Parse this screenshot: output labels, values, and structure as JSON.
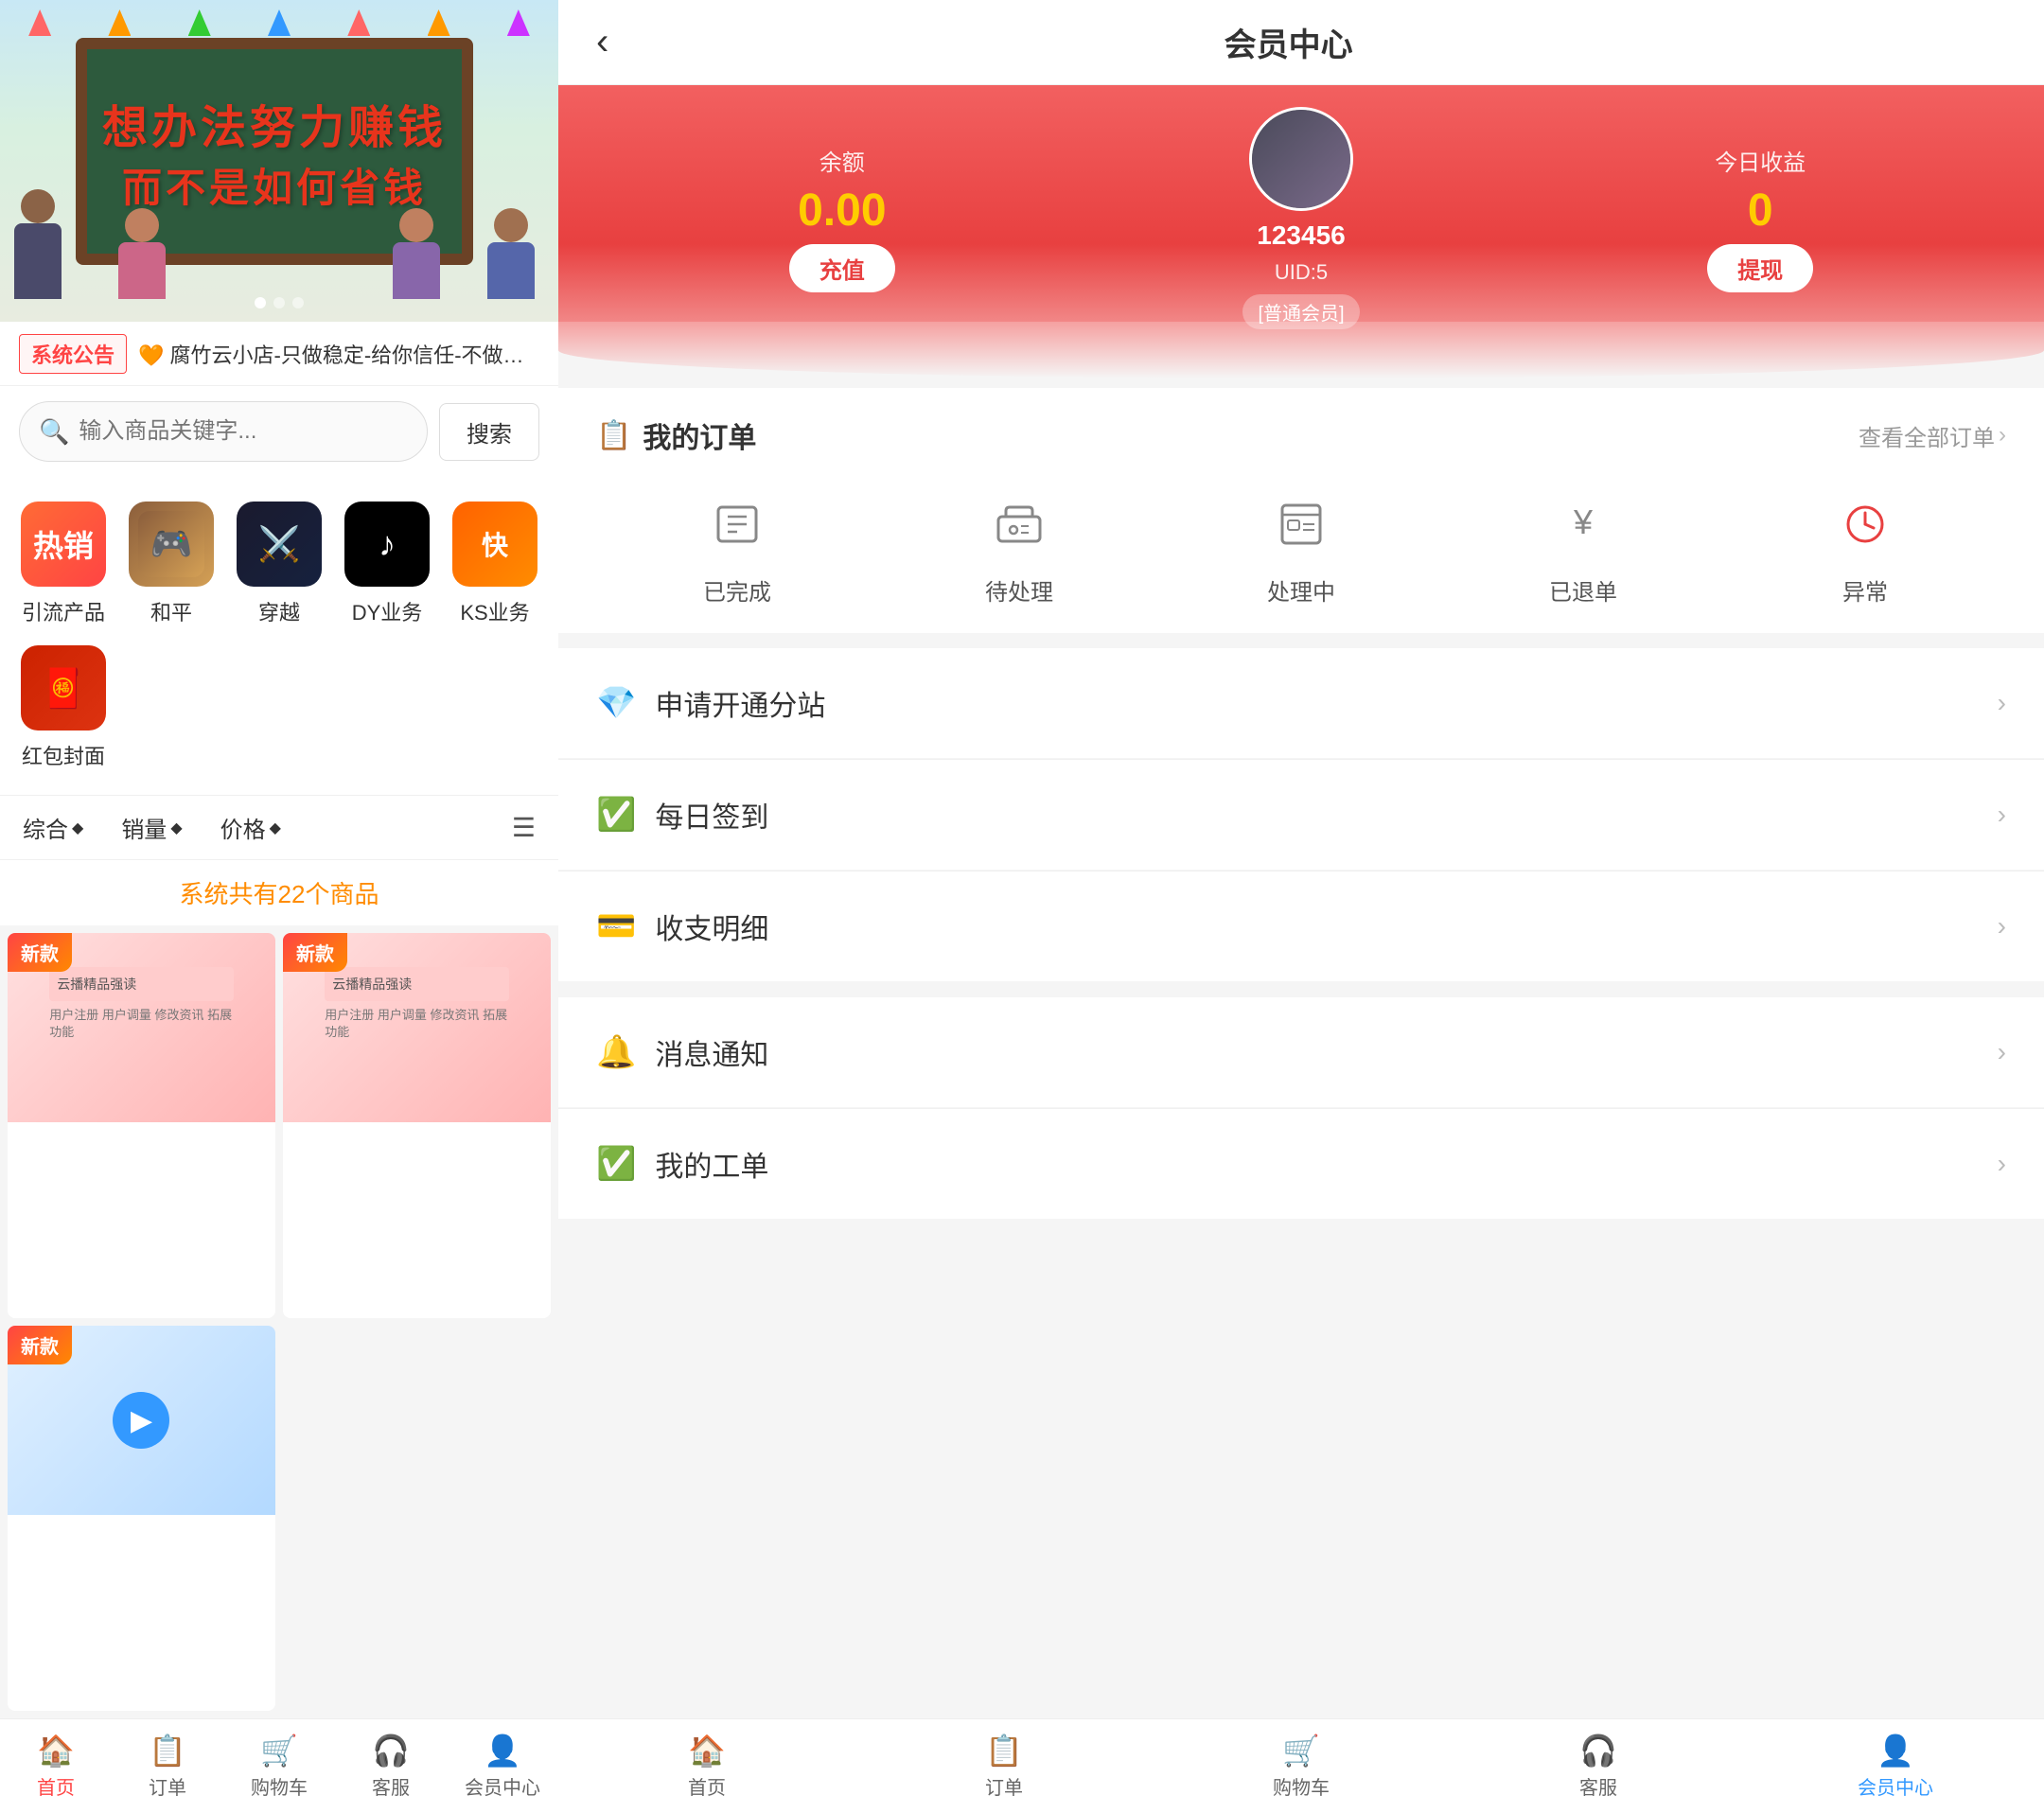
{
  "left": {
    "banner": {
      "text1": "想办法努力赚钱",
      "text2": "而不是如何省钱"
    },
    "notice": {
      "tag": "系统公告",
      "text": "🧡腐竹云小店-只做稳定-给你信任-不做跑路狗-售后稳定"
    },
    "search": {
      "placeholder": "输入商品关键字...",
      "button": "搜索"
    },
    "categories": [
      {
        "id": "hot",
        "label": "引流产品",
        "icon": "热销",
        "type": "hot"
      },
      {
        "id": "peace",
        "label": "和平",
        "icon": "",
        "type": "peace"
      },
      {
        "id": "cross",
        "label": "穿越",
        "icon": "",
        "type": "cross"
      },
      {
        "id": "dy",
        "label": "DY业务",
        "icon": "",
        "type": "dy"
      },
      {
        "id": "ks",
        "label": "KS业务",
        "icon": "",
        "type": "ks"
      },
      {
        "id": "hb",
        "label": "红包封面",
        "icon": "",
        "type": "hb"
      }
    ],
    "sort": {
      "options": [
        "综合",
        "销量",
        "价格"
      ],
      "list_icon": "☰"
    },
    "product_count": "系统共有22个商品",
    "products": [
      {
        "badge": "新款",
        "type": 1
      },
      {
        "badge": "新款",
        "type": 2
      },
      {
        "badge": "新款",
        "type": 3
      }
    ],
    "bottom_nav": [
      {
        "id": "home",
        "label": "首页",
        "icon": "🏠",
        "active": true
      },
      {
        "id": "orders",
        "label": "订单",
        "icon": "📋",
        "active": false
      },
      {
        "id": "cart",
        "label": "购物车",
        "icon": "🛒",
        "active": false
      },
      {
        "id": "service",
        "label": "客服",
        "icon": "🎧",
        "active": false
      },
      {
        "id": "member",
        "label": "会员中心",
        "icon": "👤",
        "active": false
      }
    ]
  },
  "right": {
    "header": {
      "back": "‹",
      "title": "会员中心"
    },
    "hero": {
      "balance_label": "余额",
      "balance_amount": "0.00",
      "recharge_btn": "充值",
      "username": "123456",
      "uid": "UID:5",
      "member_tag": "[普通会员]",
      "earnings_label": "今日收益",
      "earnings_amount": "0",
      "withdraw_btn": "提现"
    },
    "orders": {
      "title": "我的订单",
      "view_all": "查看全部订单",
      "statuses": [
        {
          "id": "completed",
          "label": "已完成",
          "icon": "💳"
        },
        {
          "id": "pending",
          "label": "待处理",
          "icon": "🚚"
        },
        {
          "id": "processing",
          "label": "处理中",
          "icon": "🗂️"
        },
        {
          "id": "refunded",
          "label": "已退单",
          "icon": "¥"
        },
        {
          "id": "abnormal",
          "label": "异常",
          "icon": "🕐"
        }
      ]
    },
    "menu_items": [
      {
        "id": "subsite",
        "label": "申请开通分站",
        "icon": "💎"
      },
      {
        "id": "checkin",
        "label": "每日签到",
        "icon": "✅"
      },
      {
        "id": "finance",
        "label": "收支明细",
        "icon": "💳"
      },
      {
        "id": "notification",
        "label": "消息通知",
        "icon": "🔔"
      },
      {
        "id": "workorder",
        "label": "我的工单",
        "icon": "✅"
      }
    ],
    "bottom_nav": [
      {
        "id": "home",
        "label": "首页",
        "icon": "🏠",
        "active": false
      },
      {
        "id": "orders",
        "label": "订单",
        "icon": "📋",
        "active": false
      },
      {
        "id": "cart",
        "label": "购物车",
        "icon": "🛒",
        "active": false
      },
      {
        "id": "service",
        "label": "客服",
        "icon": "🎧",
        "active": false
      },
      {
        "id": "member",
        "label": "会员中心",
        "icon": "👤",
        "active": true
      }
    ]
  }
}
